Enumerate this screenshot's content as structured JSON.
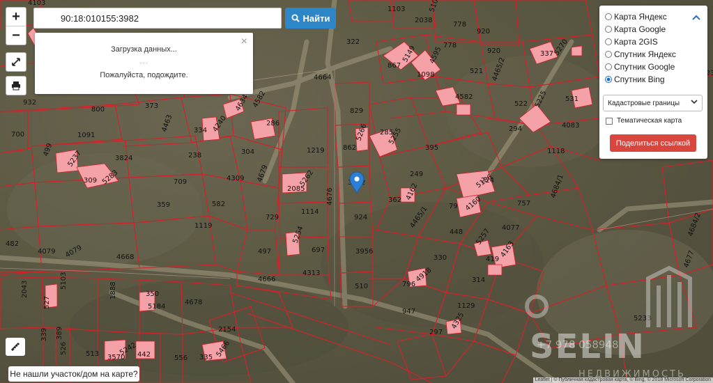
{
  "search": {
    "value": "90:18:010155:3982",
    "button_label": "Найти"
  },
  "zoom": {
    "in_label": "+",
    "out_label": "−"
  },
  "loading": {
    "title": "Загрузка данных...",
    "dots": "▫▫▫",
    "message": "Пожалуйста, подождите.",
    "close": "×"
  },
  "layers": {
    "options": [
      {
        "label": "Карта Яндекс",
        "selected": false
      },
      {
        "label": "Карта Google",
        "selected": false
      },
      {
        "label": "Карта 2GIS",
        "selected": false
      },
      {
        "label": "Спутник Яндекс",
        "selected": false
      },
      {
        "label": "Спутник Google",
        "selected": false
      },
      {
        "label": "Спутник Bing",
        "selected": true
      }
    ],
    "select_value": "Кадастровые границы",
    "thematic_label": "Тематическая карта",
    "share_label": "Поделиться ссылкой"
  },
  "not_found_label": "Не нашли участок/дом на карте?",
  "attribution": "Leaflet | © Публичная кадастровая карта, © Bing, © 2018 Microsoft Corporation",
  "watermark": {
    "brand": "SELIN",
    "caption": "НЕДВИЖИМОСТЬ",
    "phone": "+7 978 058948"
  },
  "plots": [
    {
      "t": "4103"
    },
    {
      "t": "1103"
    },
    {
      "t": "2038"
    },
    {
      "t": "5100"
    },
    {
      "t": "322"
    },
    {
      "t": "778"
    },
    {
      "t": "920"
    },
    {
      "t": "867"
    },
    {
      "t": "5149"
    },
    {
      "t": "1098"
    },
    {
      "t": "4595"
    },
    {
      "t": "778"
    },
    {
      "t": "920"
    },
    {
      "t": "337"
    },
    {
      "t": "5270"
    },
    {
      "t": "1123"
    },
    {
      "t": "521"
    },
    {
      "t": "4664"
    },
    {
      "t": "4582"
    },
    {
      "t": "4465/2"
    },
    {
      "t": "522"
    },
    {
      "t": "5225"
    },
    {
      "t": "531"
    },
    {
      "t": "932"
    },
    {
      "t": "800"
    },
    {
      "t": "373"
    },
    {
      "t": "4634"
    },
    {
      "t": "4582"
    },
    {
      "t": "829"
    },
    {
      "t": "294"
    },
    {
      "t": "4083"
    },
    {
      "t": "700"
    },
    {
      "t": "1091"
    },
    {
      "t": "4463"
    },
    {
      "t": "334"
    },
    {
      "t": "4240"
    },
    {
      "t": "286"
    },
    {
      "t": "285"
    },
    {
      "t": "5255"
    },
    {
      "t": "499"
    },
    {
      "t": "5237"
    },
    {
      "t": "3824"
    },
    {
      "t": "238"
    },
    {
      "t": "304"
    },
    {
      "t": "1219"
    },
    {
      "t": "862"
    },
    {
      "t": "5266"
    },
    {
      "t": "395"
    },
    {
      "t": "1118"
    },
    {
      "t": "309"
    },
    {
      "t": "5283"
    },
    {
      "t": "709"
    },
    {
      "t": "4309"
    },
    {
      "t": "4679"
    },
    {
      "t": "2085"
    },
    {
      "t": "5262"
    },
    {
      "t": "3982"
    },
    {
      "t": "249"
    },
    {
      "t": "224"
    },
    {
      "t": "5186"
    },
    {
      "t": "359"
    },
    {
      "t": "582"
    },
    {
      "t": "1114"
    },
    {
      "t": "4676"
    },
    {
      "t": "362"
    },
    {
      "t": "4162"
    },
    {
      "t": "79"
    },
    {
      "t": "4160"
    },
    {
      "t": "757"
    },
    {
      "t": "4684/1"
    },
    {
      "t": "1119"
    },
    {
      "t": "729"
    },
    {
      "t": "924"
    },
    {
      "t": "4465/1"
    },
    {
      "t": "448"
    },
    {
      "t": "4077"
    },
    {
      "t": "482"
    },
    {
      "t": "4079"
    },
    {
      "t": "4079"
    },
    {
      "t": "4668"
    },
    {
      "t": "497"
    },
    {
      "t": "5254"
    },
    {
      "t": "697"
    },
    {
      "t": "3956"
    },
    {
      "t": "5257"
    },
    {
      "t": "4163"
    },
    {
      "t": "4684/2"
    },
    {
      "t": "330"
    },
    {
      "t": "419"
    },
    {
      "t": "4677"
    },
    {
      "t": "4666"
    },
    {
      "t": "4313"
    },
    {
      "t": "510"
    },
    {
      "t": "796"
    },
    {
      "t": "4918"
    },
    {
      "t": "314"
    },
    {
      "t": "2043"
    },
    {
      "t": "527"
    },
    {
      "t": "5103"
    },
    {
      "t": "1888"
    },
    {
      "t": "350"
    },
    {
      "t": "5184"
    },
    {
      "t": "4678"
    },
    {
      "t": "1129"
    },
    {
      "t": "947"
    },
    {
      "t": "5233"
    },
    {
      "t": "2154"
    },
    {
      "t": "297"
    },
    {
      "t": "4325"
    },
    {
      "t": "339"
    },
    {
      "t": "526"
    },
    {
      "t": "389"
    },
    {
      "t": "513"
    },
    {
      "t": "3570"
    },
    {
      "t": "5242"
    },
    {
      "t": "442"
    },
    {
      "t": "556"
    },
    {
      "t": "335"
    },
    {
      "t": "5466"
    }
  ]
}
